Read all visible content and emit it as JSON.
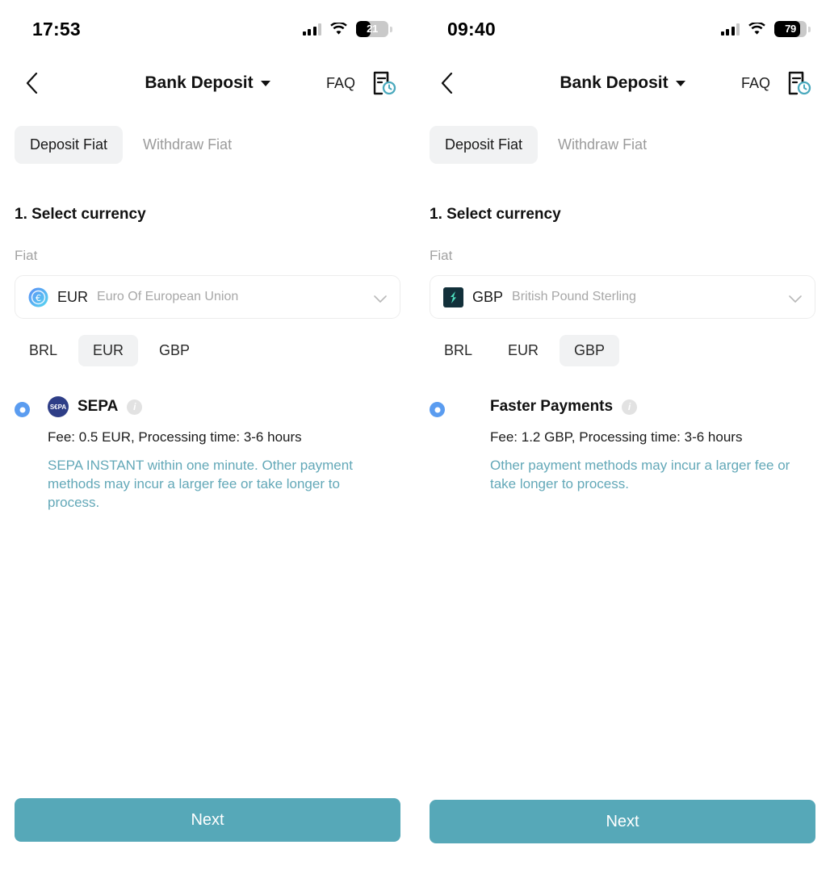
{
  "accent": "#56a8b8",
  "note_color": "#63a8b8",
  "radio_color": "#5a9cf0",
  "screens": [
    {
      "status": {
        "time": "17:53",
        "battery_level": "21",
        "battery_percent": 21,
        "signal_icon": "cellular-bars-icon",
        "wifi_icon": "wifi-icon",
        "battery_icon": "battery-icon"
      },
      "nav": {
        "back_icon": "back-chevron-icon",
        "title": "Bank Deposit",
        "caret_icon": "chevron-down-icon",
        "faq_label": "FAQ",
        "history_icon": "order-history-document-icon"
      },
      "tabs": [
        {
          "label": "Deposit Fiat",
          "active": true
        },
        {
          "label": "Withdraw Fiat",
          "active": false
        }
      ],
      "section": {
        "title": "1. Select currency",
        "field_label": "Fiat",
        "select": {
          "icon": "eur-coin-icon",
          "code": "EUR",
          "name": "Euro Of European Union",
          "chevron_icon": "chevron-down-icon"
        },
        "chips": [
          {
            "label": "BRL",
            "active": false
          },
          {
            "label": "EUR",
            "active": true
          },
          {
            "label": "GBP",
            "active": false
          }
        ]
      },
      "payment_method": {
        "selected": true,
        "logo_icon": "sepa-logo-icon",
        "logo_text": "SEPA",
        "name": "SEPA",
        "info_icon": "info-icon",
        "fee": "Fee: 0.5 EUR, Processing time: 3-6 hours",
        "note": "SEPA INSTANT within one minute. Other payment methods may incur a larger fee or take longer to process."
      },
      "next_label": "Next"
    },
    {
      "status": {
        "time": "09:40",
        "battery_level": "79",
        "battery_percent": 79,
        "signal_icon": "cellular-bars-icon",
        "wifi_icon": "wifi-icon",
        "battery_icon": "battery-icon"
      },
      "nav": {
        "back_icon": "back-chevron-icon",
        "title": "Bank Deposit",
        "caret_icon": "chevron-down-icon",
        "faq_label": "FAQ",
        "history_icon": "order-history-document-icon"
      },
      "tabs": [
        {
          "label": "Deposit Fiat",
          "active": true
        },
        {
          "label": "Withdraw Fiat",
          "active": false
        }
      ],
      "section": {
        "title": "1. Select currency",
        "field_label": "Fiat",
        "select": {
          "icon": "gbp-token-icon",
          "code": "GBP",
          "name": "British Pound Sterling",
          "chevron_icon": "chevron-down-icon"
        },
        "chips": [
          {
            "label": "BRL",
            "active": false
          },
          {
            "label": "EUR",
            "active": false
          },
          {
            "label": "GBP",
            "active": true
          }
        ]
      },
      "payment_method": {
        "selected": true,
        "logo_icon": "none",
        "logo_text": "",
        "name": "Faster Payments",
        "info_icon": "info-icon",
        "fee": "Fee: 1.2 GBP, Processing time: 3-6 hours",
        "note": "Other payment methods may incur a larger fee or take longer to process."
      },
      "next_label": "Next"
    }
  ]
}
